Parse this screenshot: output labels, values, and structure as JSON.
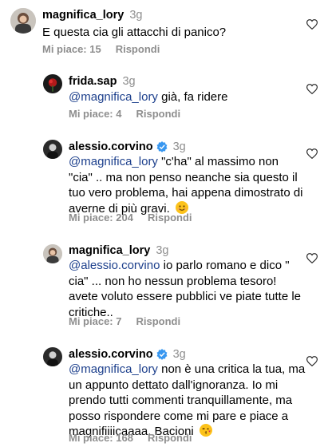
{
  "comments": [
    {
      "username": "magnifica_lory",
      "time": "3g",
      "mention": "",
      "text": "E questa cia gli attacchi di panico?",
      "likes": "Mi piace: 15",
      "reply": "Rispondi"
    },
    {
      "username": "frida.sap",
      "time": "3g",
      "mention": "@magnifica_lory",
      "text": " già, fa ridere",
      "likes": "Mi piace: 4",
      "reply": "Rispondi"
    },
    {
      "username": "alessio.corvino",
      "verified": true,
      "time": "3g",
      "mention": "@magnifica_lory",
      "lines": [
        " \"c'ha\" al massimo non",
        "\"cia\" .. ma non penso neanche sia questo il",
        "tuo vero problema, hai appena dimostrato di",
        "averne di più gravi. "
      ],
      "emoji": "smiling-face-emoji",
      "likes": "Mi piace: 204",
      "reply": "Rispondi"
    },
    {
      "username": "magnifica_lory",
      "time": "3g",
      "mention": "@alessio.corvino",
      "lines": [
        " io parlo romano e dico \"",
        "cia\" ... non ho nessun problema tesoro!",
        "avete voluto essere pubblici ve piate tutte le",
        "critiche.."
      ],
      "likes": "Mi piace: 7",
      "reply": "Rispondi"
    },
    {
      "username": "alessio.corvino",
      "verified": true,
      "time": "3g",
      "mention": "@magnifica_lory",
      "lines": [
        " non è una critica la tua, ma",
        "un appunto dettato dall'ignoranza. Io mi",
        "prendo tutti commenti tranquillamente, ma",
        "posso rispondere come mi pare e piace a",
        "magnifiiiicaaaa. Bacioni "
      ],
      "emoji": "kissing-face-emoji",
      "likes": "Mi piace: 168",
      "reply": "Rispondi"
    }
  ],
  "colors": {
    "mention": "#1c3f8c",
    "meta": "#8e8e8e",
    "verified": "#3897f0"
  }
}
